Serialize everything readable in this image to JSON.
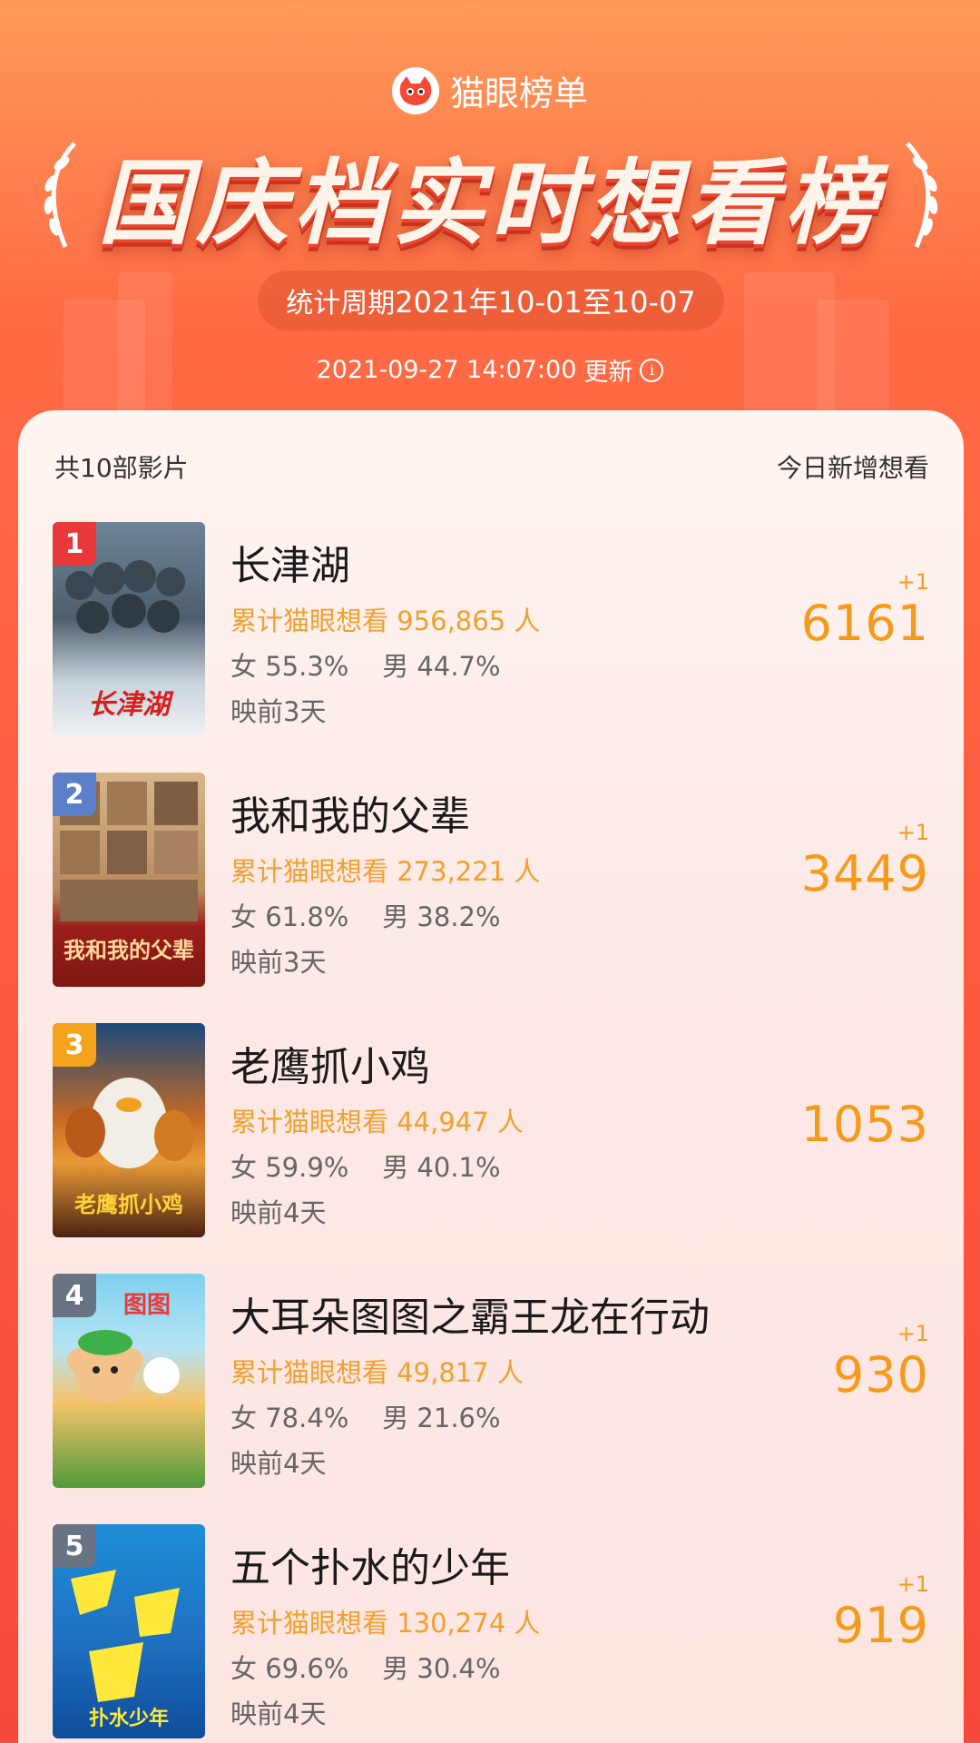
{
  "header": {
    "brand": "猫眼榜单",
    "title": "国庆档实时想看榜",
    "period_prefix": "统计周期",
    "period_range": "2021年10-01至10-07",
    "updated_time": "2021-09-27 14:07:00",
    "updated_label": "更新",
    "info_icon": "i"
  },
  "list": {
    "count_label": "共10部影片",
    "column_label": "今日新增想看"
  },
  "colors": {
    "accent_orange": "#f59b1c",
    "wish_gold": "#f0a02e",
    "rank1": "#e8383a",
    "rank2": "#5b7fc9",
    "rank3": "#f5a31a",
    "rank_other": "#6a7384"
  },
  "movies": [
    {
      "rank": "1",
      "title": "长津湖",
      "wish": "累计猫眼想看 956,865 人",
      "gender": "女 55.3%    男 44.7%",
      "days": "映前3天",
      "delta": "+1",
      "today": "6161",
      "poster_text": "长津湖"
    },
    {
      "rank": "2",
      "title": "我和我的父辈",
      "wish": "累计猫眼想看 273,221 人",
      "gender": "女 61.8%    男 38.2%",
      "days": "映前3天",
      "delta": "+1",
      "today": "3449",
      "poster_text": "我和我的父辈"
    },
    {
      "rank": "3",
      "title": "老鹰抓小鸡",
      "wish": "累计猫眼想看 44,947 人",
      "gender": "女 59.9%    男 40.1%",
      "days": "映前4天",
      "delta": "",
      "today": "1053",
      "poster_text": "老鹰抓小鸡"
    },
    {
      "rank": "4",
      "title": "大耳朵图图之霸王龙在行动",
      "wish": "累计猫眼想看 49,817 人",
      "gender": "女 78.4%    男 21.6%",
      "days": "映前4天",
      "delta": "+1",
      "today": "930",
      "poster_text": "图图"
    },
    {
      "rank": "5",
      "title": "五个扑水的少年",
      "wish": "累计猫眼想看 130,274 人",
      "gender": "女 69.6%    男 30.4%",
      "days": "映前4天",
      "delta": "+1",
      "today": "919",
      "poster_text": "扑水少年"
    }
  ]
}
